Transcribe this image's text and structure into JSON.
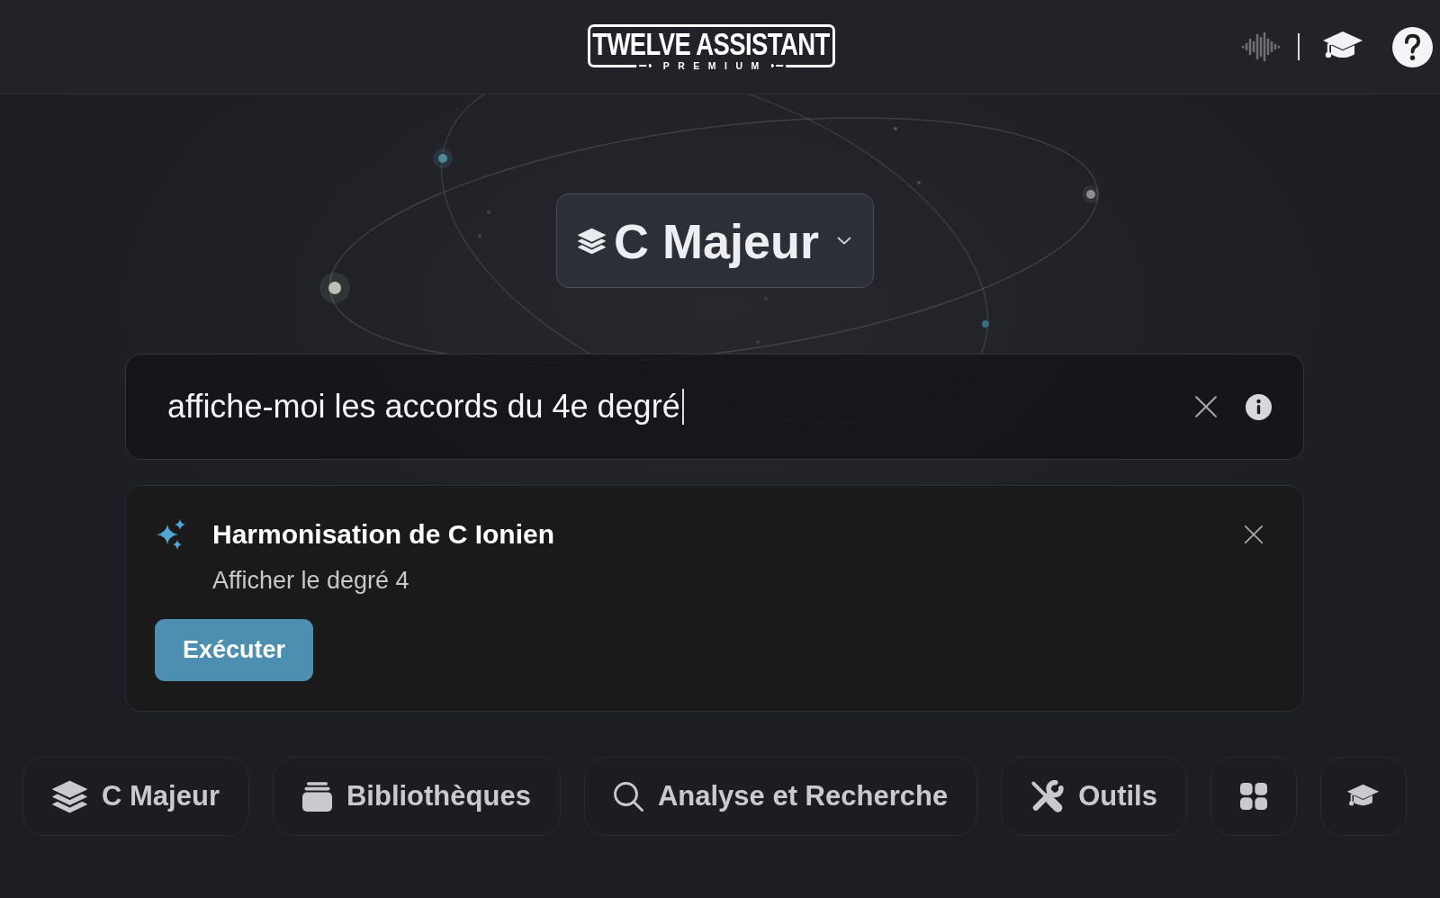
{
  "header": {
    "logo": {
      "title": "TWELVE ASSISTANT",
      "subtitle": "PREMIUM"
    }
  },
  "scale_selector": {
    "label": "C Majeur"
  },
  "command_bar": {
    "value": "affiche-moi les accords du 4e degré"
  },
  "suggestion": {
    "title": "Harmonisation de C Ionien",
    "description": "Afficher le degré 4",
    "action": "Exécuter"
  },
  "toolbar": [
    {
      "kind": "scale",
      "label": "C Majeur"
    },
    {
      "kind": "libraries",
      "label": "Bibliothèques"
    },
    {
      "kind": "search",
      "label": "Analyse et Recherche"
    },
    {
      "kind": "tools",
      "label": "Outils"
    },
    {
      "kind": "apps"
    },
    {
      "kind": "learn"
    }
  ]
}
